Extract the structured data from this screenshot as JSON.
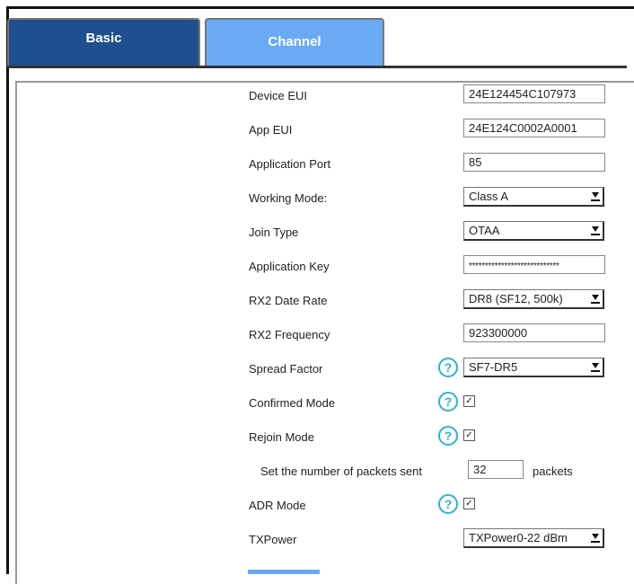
{
  "tabs": {
    "basic": "Basic",
    "channel": "Channel"
  },
  "form": {
    "device_eui": {
      "label": "Device EUI",
      "value": "24E124454C107973"
    },
    "app_eui": {
      "label": "App EUI",
      "value": "24E124C0002A0001"
    },
    "application_port": {
      "label": "Application Port",
      "value": "85"
    },
    "working_mode": {
      "label": "Working Mode:",
      "value": "Class A"
    },
    "join_type": {
      "label": "Join Type",
      "value": "OTAA"
    },
    "application_key": {
      "label": "Application Key",
      "value": "****************************"
    },
    "rx2_data_rate": {
      "label": "RX2 Date Rate",
      "value": "DR8 (SF12, 500k)"
    },
    "rx2_frequency": {
      "label": "RX2 Frequency",
      "value": "923300000"
    },
    "spread_factor": {
      "label": "Spread Factor",
      "value": "SF7-DR5"
    },
    "confirmed_mode": {
      "label": "Confirmed Mode",
      "checked": true
    },
    "rejoin_mode": {
      "label": "Rejoin Mode",
      "checked": true
    },
    "packets": {
      "label": "Set the number of packets sent",
      "value": "32",
      "unit": "packets"
    },
    "adr_mode": {
      "label": "ADR Mode",
      "checked": true
    },
    "tx_power": {
      "label": "TXPower",
      "value": "TXPower0-22 dBm"
    }
  },
  "icons": {
    "help": "?",
    "check": "✓"
  },
  "colors": {
    "tab_basic": "#1f4f8f",
    "tab_channel": "#6aaaf4",
    "help_icon": "#2bb3d9"
  }
}
